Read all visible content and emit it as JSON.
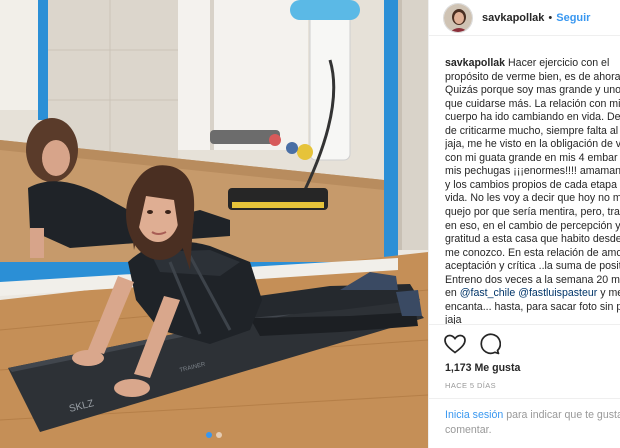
{
  "post": {
    "username": "savkapollak",
    "header_separator": "•",
    "follow_label": "Seguir"
  },
  "caption": {
    "username": "savkapollak",
    "lines": [
      "Hacer ejercicio con el",
      "propósito de verme bien, es de ahora.",
      "Quizás porque soy mas grande y uno",
      "que cuidarse más. La relación con mi",
      "cuerpo ha ido cambiando en vida. De",
      "de criticarme mucho, siempre falta al",
      "jaja, me he visto en la obligación de v",
      "con mi guata grande en mis 4 embar",
      "mis pechugas ¡¡¡enormes!!!! amamant",
      "y los cambios propios de cada etapa",
      "vida. No les voy a decir que hoy no m",
      "quejo por que sería mentira, pero, tra",
      "en eso, en el cambio de percepción y",
      "gratitud a esta casa que habito desde",
      "me conozco. En esta relación de amo",
      "aceptación y crítica ..la suma de posit",
      "Entreno dos veces a la semana 20 mi",
      "en",
      "encanta... hasta, para sacar foto sin po",
      "jaja"
    ],
    "tag1": "@fast_chile",
    "tag2": "@fastluispasteur",
    "tag_suffix": " y me"
  },
  "actions": {
    "like_icon": "heart-icon",
    "comment_icon": "comment-icon"
  },
  "likes_text": "1,173 Me gusta",
  "time_ago": "HACE 5 DÍAS",
  "login": {
    "link_label": "Inicia sesión",
    "text": " para indicar que te gusta",
    "text2": "comentar."
  },
  "carousel": {
    "count": 2,
    "active": 1
  }
}
